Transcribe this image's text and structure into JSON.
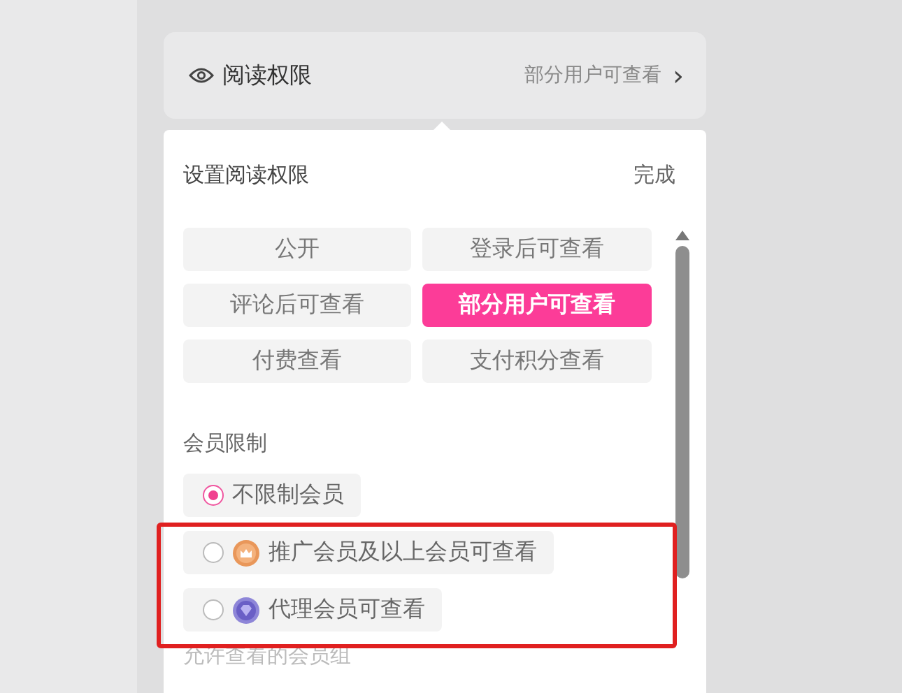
{
  "header": {
    "label": "阅读权限",
    "value": "部分用户可查看",
    "chevron": "›"
  },
  "popup": {
    "title": "设置阅读权限",
    "done": "完成",
    "options": [
      {
        "label": "公开",
        "selected": false
      },
      {
        "label": "登录后可查看",
        "selected": false
      },
      {
        "label": "评论后可查看",
        "selected": false
      },
      {
        "label": "部分用户可查看",
        "selected": true
      },
      {
        "label": "付费查看",
        "selected": false
      },
      {
        "label": "支付积分查看",
        "selected": false
      }
    ],
    "member_section": {
      "title": "会员限制",
      "choices": [
        {
          "label": "不限制会员",
          "selected": true
        },
        {
          "label": "推广会员及以上会员可查看",
          "selected": false,
          "kind": "crown"
        },
        {
          "label": "代理会员可查看",
          "selected": false,
          "kind": "gem"
        }
      ],
      "next_label": "允许查看的会员组"
    }
  }
}
